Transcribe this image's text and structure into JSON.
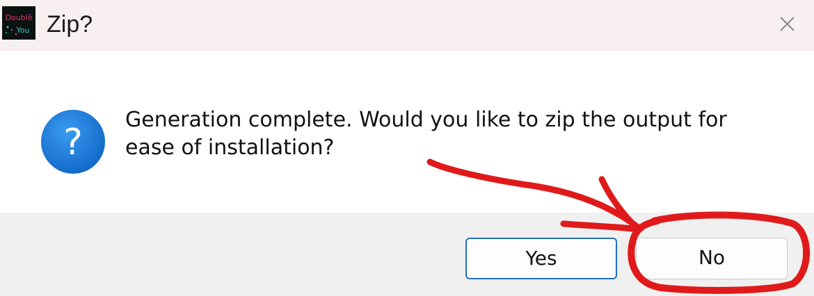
{
  "window": {
    "title": "Zip?",
    "app_icon_text": [
      "Double",
      "You"
    ],
    "close_icon": "close-icon"
  },
  "dialog": {
    "icon": "question-icon",
    "message_line1": "Generation complete. Would you like to zip the output for",
    "message_line2": "ease of installation?"
  },
  "buttons": {
    "yes_label": "Yes",
    "no_label": "No"
  },
  "colors": {
    "titlebar_bg": "#f7eff0",
    "footer_bg": "#f0f0f0",
    "default_button_border": "#1f6fc5",
    "question_icon": "#1d7ed6",
    "annotation": "#e01a1a"
  },
  "annotation": {
    "type": "hand-drawn red arrow and circle highlighting the No button"
  }
}
